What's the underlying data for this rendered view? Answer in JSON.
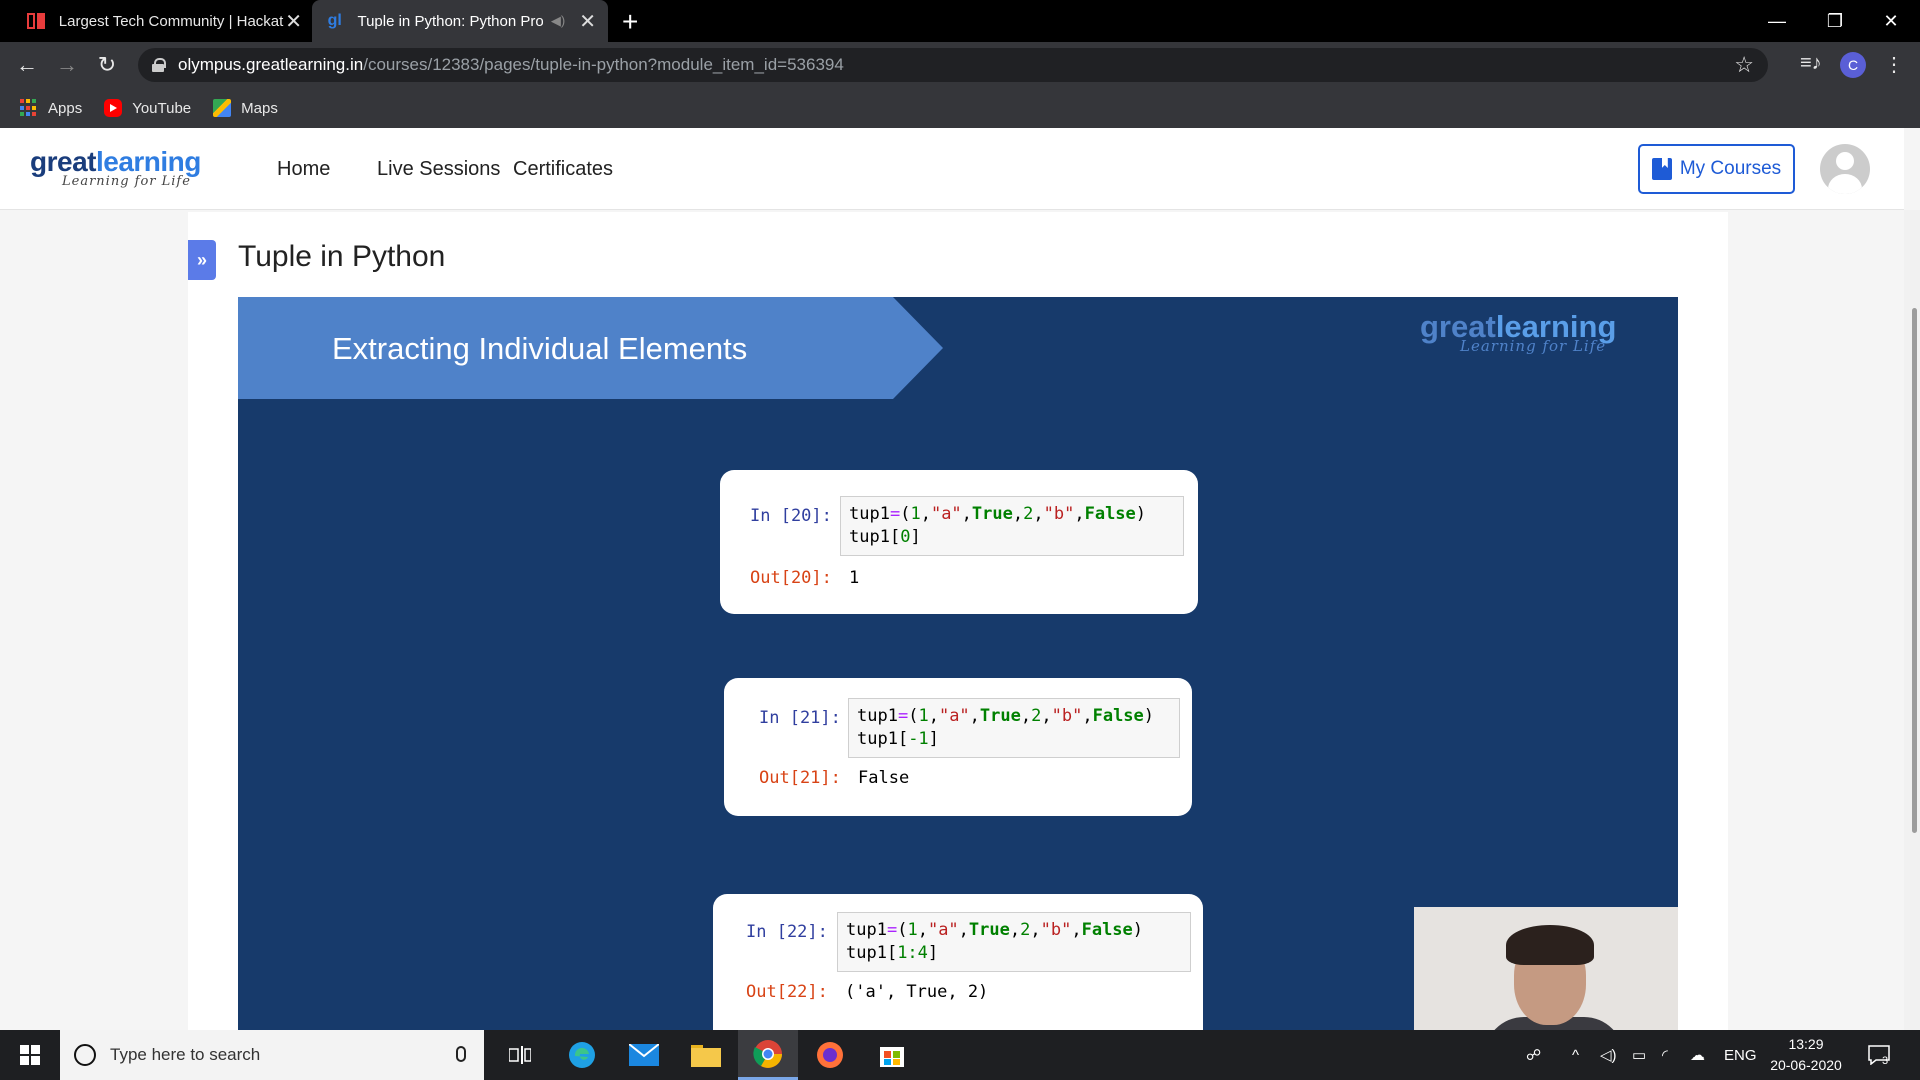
{
  "browser": {
    "tabs": [
      {
        "title": "Largest Tech Community | Hackat",
        "favicon": "hackerearth-icon"
      },
      {
        "title": "Tuple in Python: Python Prog",
        "favicon": "greatlearning-icon",
        "active": true
      }
    ],
    "url_host": "olympus.greatlearning.in",
    "url_path": "/courses/12383/pages/tuple-in-python?module_item_id=536394",
    "profile_initial": "C",
    "bookmarks": [
      {
        "label": "Apps",
        "icon": "apps-icon"
      },
      {
        "label": "YouTube",
        "icon": "youtube-icon"
      },
      {
        "label": "Maps",
        "icon": "maps-icon"
      }
    ]
  },
  "site": {
    "logo_word_1": "great",
    "logo_word_2": "learning",
    "logo_tagline": "Learning for Life",
    "nav": [
      "Home",
      "Live Sessions",
      "Certificates"
    ],
    "my_courses_label": "My Courses",
    "accent": "#1e5bd6"
  },
  "page": {
    "title": "Tuple in Python",
    "expand_icon": "»"
  },
  "video": {
    "banner_title": "Extracting Individual Elements",
    "logo_word_1": "great",
    "logo_word_2": "learning",
    "logo_tagline": "Learning for Life",
    "cells": [
      {
        "in_label": "In [20]:",
        "line2_prefix": "tup1[",
        "line2_index": "0",
        "line2_suffix": "]",
        "out_label": "Out[20]:",
        "output": "1"
      },
      {
        "in_label": "In [21]:",
        "line2_prefix": "tup1[",
        "line2_index": "-1",
        "line2_suffix": "]",
        "out_label": "Out[21]:",
        "output": "False"
      },
      {
        "in_label": "In [22]:",
        "line2_prefix": "tup1[",
        "line2_index": "1:4",
        "line2_suffix": "]",
        "out_label": "Out[22]:",
        "output": "('a', True, 2)"
      }
    ],
    "code_line1": {
      "var": "tup1",
      "eq": "=",
      "open": "(",
      "n1": "1",
      "c1": ",",
      "s1": "\"a\"",
      "c2": ",",
      "kw1": "True",
      "c3": ",",
      "n2": "2",
      "c4": ",",
      "s2": "\"b\"",
      "c5": ",",
      "kw2": "False",
      "close": ")"
    }
  },
  "taskbar": {
    "search_placeholder": "Type here to search",
    "language": "ENG",
    "time": "13:29",
    "date": "20-06-2020",
    "notifications": "3"
  }
}
